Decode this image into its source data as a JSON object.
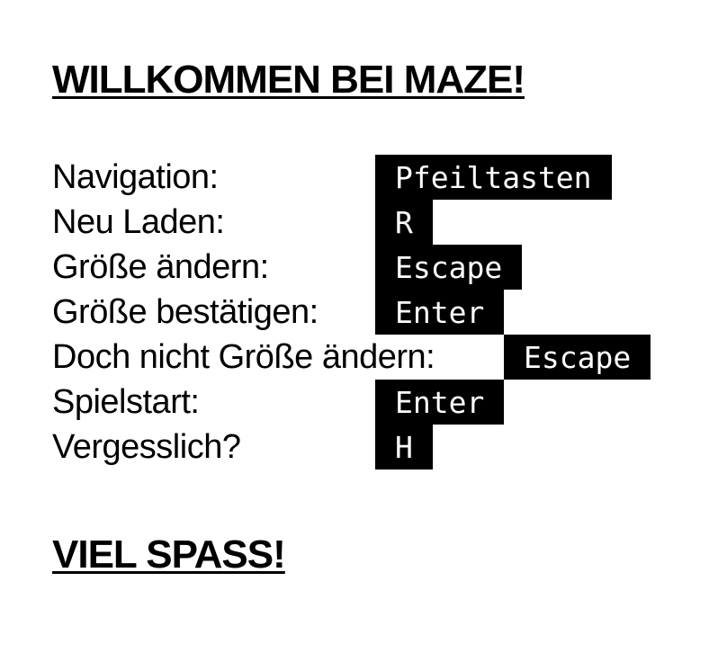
{
  "heading": "WILLKOMMEN BEI MAZE!",
  "controls": [
    {
      "label": "Navigation:",
      "key": "Pfeiltasten"
    },
    {
      "label": "Neu Laden:",
      "key": "R"
    },
    {
      "label": "Größe ändern:",
      "key": "Escape"
    },
    {
      "label": "Größe bestätigen:",
      "key": "Enter"
    },
    {
      "label": "Doch nicht Größe ändern:",
      "key": "Escape"
    },
    {
      "label": "Spielstart:",
      "key": "Enter"
    },
    {
      "label": "Vergesslich?",
      "key": "H"
    }
  ],
  "footer": "VIEL SPASS!",
  "colors": {
    "background": "#ffffff",
    "text": "#000000",
    "key_background": "#000000",
    "key_text": "#ffffff"
  }
}
